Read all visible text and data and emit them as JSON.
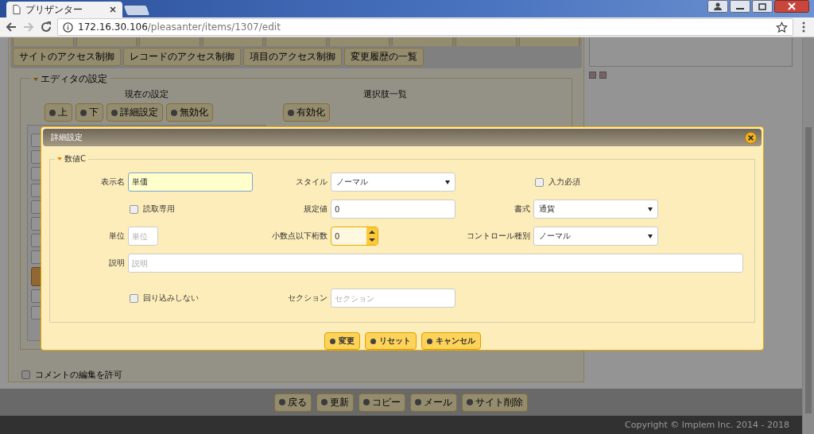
{
  "browser": {
    "tab_title": "プリザンター",
    "url_host": "172.16.30.106",
    "url_path": "/pleasanter/items/1307/edit"
  },
  "background": {
    "tabs": [
      "サイトのアクセス制御",
      "レコードのアクセス制御",
      "項目のアクセス制御",
      "変更履歴の一覧"
    ],
    "section_legend": "エディタの設定",
    "current_label": "現在の設定",
    "options_label": "選択肢一覧",
    "current_buttons": [
      "上",
      "下",
      "詳細設定",
      "無効化"
    ],
    "options_buttons": [
      "有効化"
    ],
    "list_items": [
      {
        "selected": false
      },
      {
        "selected": false
      },
      {
        "selected": false
      },
      {
        "selected": false
      },
      {
        "selected": false
      },
      {
        "selected": false
      },
      {
        "selected": false
      },
      {
        "selected": false
      },
      {
        "selected": true
      },
      {
        "selected": false
      },
      {
        "selected": false
      }
    ],
    "comment_checkbox": {
      "label": "コメントの編集を許可",
      "checked": false
    },
    "footer_buttons": [
      "戻る",
      "更新",
      "コピー",
      "メール",
      "サイト削除"
    ],
    "copyright": "Copyright © Implem Inc. 2014 - 2018"
  },
  "dialog": {
    "title": "詳細設定",
    "legend": "数値C",
    "rows": [
      [
        {
          "kind": "text",
          "label": "表示名",
          "value": "単価",
          "focused": true
        },
        {
          "kind": "select",
          "label": "スタイル",
          "value": "ノーマル"
        },
        {
          "kind": "checkbox",
          "text": "入力必須",
          "checked": false
        }
      ],
      [
        {
          "kind": "checkbox",
          "text": "読取専用",
          "checked": false
        },
        {
          "kind": "text",
          "label": "規定値",
          "value": "0",
          "focused": false
        },
        {
          "kind": "select",
          "label": "書式",
          "value": "通貨"
        }
      ],
      [
        {
          "kind": "short-text",
          "label": "単位",
          "placeholder": "単位"
        },
        {
          "kind": "spinner",
          "label": "小数点以下桁数",
          "value": "0"
        },
        {
          "kind": "select",
          "label": "コントロール種別",
          "value": "ノーマル"
        }
      ],
      [
        {
          "kind": "long-text",
          "label": "説明",
          "placeholder": "説明"
        }
      ],
      [
        {
          "kind": "checkbox",
          "text": "回り込みしない",
          "checked": false
        },
        {
          "kind": "text",
          "label": "セクション",
          "placeholder": "セクション",
          "focused": false
        }
      ]
    ],
    "buttons": [
      "変更",
      "リセット",
      "キャンセル"
    ]
  }
}
